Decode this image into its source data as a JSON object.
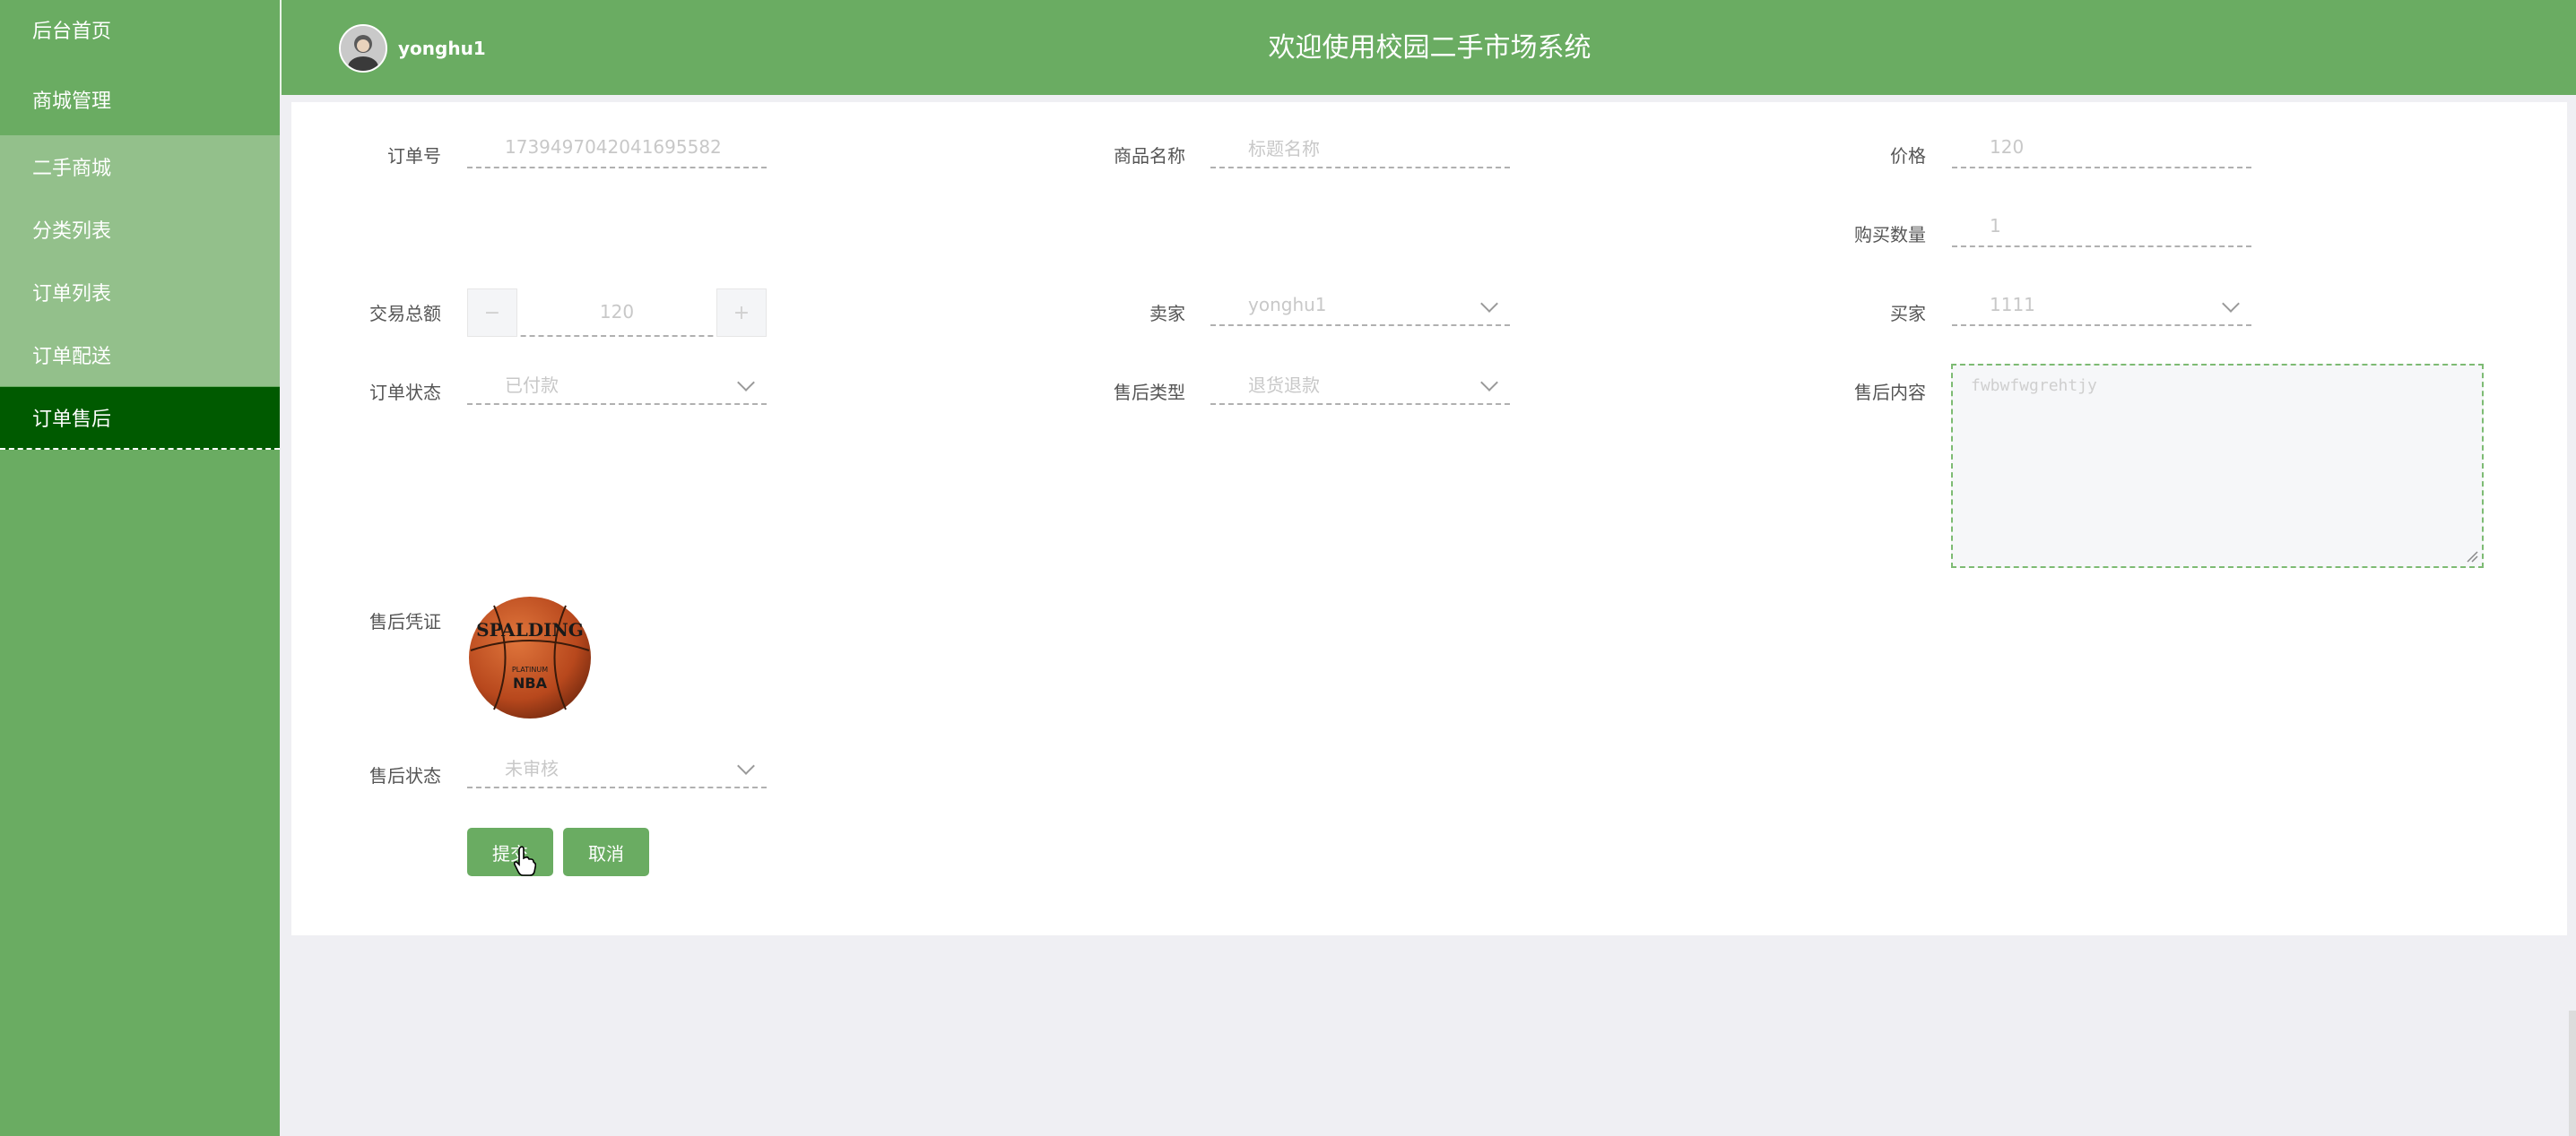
{
  "sidebar": {
    "items": [
      {
        "label": "后台首页"
      },
      {
        "label": "商城管理"
      },
      {
        "label": "二手商城"
      },
      {
        "label": "分类列表"
      },
      {
        "label": "订单列表"
      },
      {
        "label": "订单配送"
      },
      {
        "label": "订单售后"
      }
    ]
  },
  "header": {
    "username": "yonghu1",
    "title": "欢迎使用校园二手市场系统"
  },
  "form": {
    "order_no": {
      "label": "订单号",
      "value": "1739497042041695582"
    },
    "product_name": {
      "label": "商品名称",
      "placeholder": "标题名称"
    },
    "price": {
      "label": "价格",
      "value": "120"
    },
    "quantity": {
      "label": "购买数量",
      "value": "1"
    },
    "total": {
      "label": "交易总额",
      "value": "120",
      "minus": "−",
      "plus": "+"
    },
    "seller": {
      "label": "卖家",
      "value": "yonghu1"
    },
    "buyer": {
      "label": "买家",
      "value": "1111"
    },
    "order_status": {
      "label": "订单状态",
      "value": "已付款"
    },
    "aftersale_type": {
      "label": "售后类型",
      "value": "退货退款"
    },
    "aftersale_content": {
      "label": "售后内容",
      "value": "fwbwfwgrehtjy"
    },
    "aftersale_proof": {
      "label": "售后凭证",
      "brand": "SPALDING",
      "sub": "PLATINUM",
      "logo": "NBA"
    },
    "aftersale_status": {
      "label": "售后状态",
      "value": "未审核"
    },
    "submit_label": "提交",
    "cancel_label": "取消"
  },
  "colors": {
    "primary": "#6aac62",
    "active": "#005a00",
    "submenu": "#93c08b",
    "background": "#efeff3"
  }
}
